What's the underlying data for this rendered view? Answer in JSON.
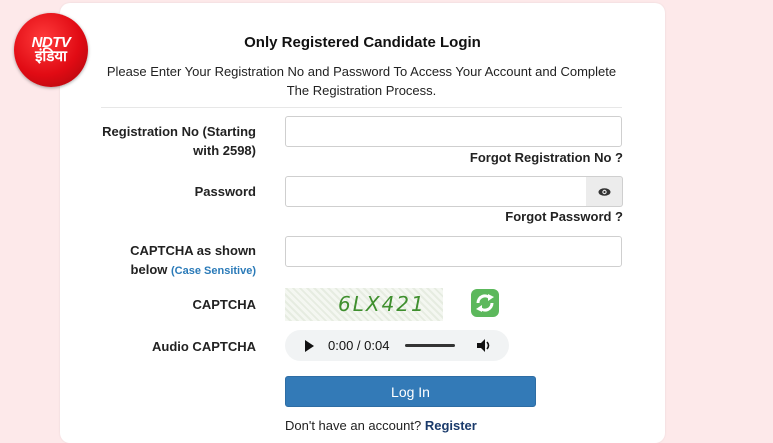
{
  "logo": {
    "line1": "NDTV",
    "line2": "इंडिया"
  },
  "header": {
    "title": "Only Registered Candidate Login",
    "subtitle": "Please Enter Your Registration No and Password To Access Your Account and Complete The Registration Process."
  },
  "form": {
    "registration_label_line1": "Registration No (Starting",
    "registration_label_line2": "with 2598)",
    "registration_value": "",
    "forgot_registration": "Forgot Registration No ?",
    "password_label": "Password",
    "password_value": "",
    "forgot_password": "Forgot Password ?",
    "captcha_input_label_line1": "CAPTCHA as shown",
    "captcha_input_label_line2": "below",
    "captcha_case_hint": "(Case Sensitive)",
    "captcha_value": "",
    "captcha_label": "CAPTCHA",
    "captcha_text": "6LX421",
    "audio_label": "Audio CAPTCHA",
    "audio_time": "0:00 / 0:04",
    "login_button": "Log In",
    "no_account_text": "Don't have an account?",
    "register_link": "Register"
  },
  "icons": {
    "password_toggle": "eye-icon",
    "captcha_refresh": "refresh-icon",
    "audio_play": "play-icon",
    "audio_volume": "volume-icon"
  },
  "colors": {
    "brand_red": "#e10b14",
    "primary_button": "#337ab7",
    "hint_blue": "#2a7ab8",
    "captcha_green": "#3f8f2e"
  }
}
